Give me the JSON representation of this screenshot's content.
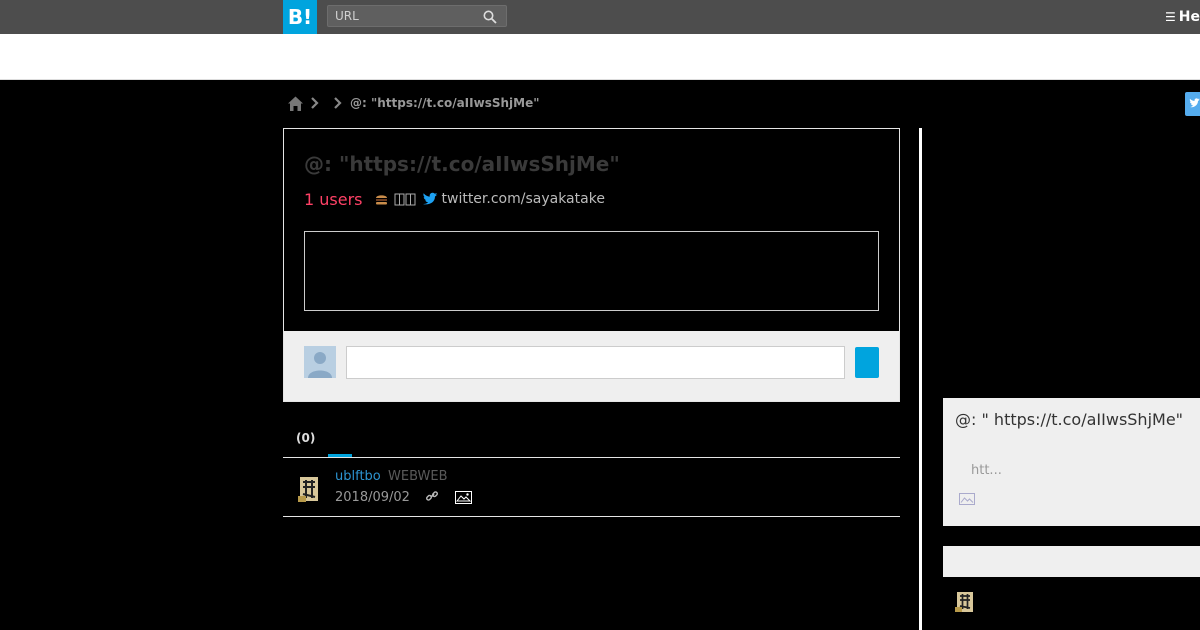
{
  "topbar": {
    "logo": "B!",
    "search_placeholder": "URL",
    "right_text": "He"
  },
  "breadcrumb": {
    "current": "@: \"https://t.co/aIIwsShjMe\""
  },
  "entry": {
    "title": "@: \"https://t.co/aIIwsShjMe\"",
    "users": "1 users",
    "host": "twitter.com/sayakatake"
  },
  "tabs": {
    "count": "(0)"
  },
  "bookmark": {
    "user": "ublftbo",
    "tags": "WEBWEB",
    "date": "2018/09/02"
  },
  "related": {
    "title": "@: \" https://t.co/aIIwsShjMe\"",
    "snippet": "htt..."
  },
  "colors": {
    "brand": "#00a4de",
    "users": "#ff4166",
    "username": "#2d94d1",
    "twitter": "#55acee"
  }
}
